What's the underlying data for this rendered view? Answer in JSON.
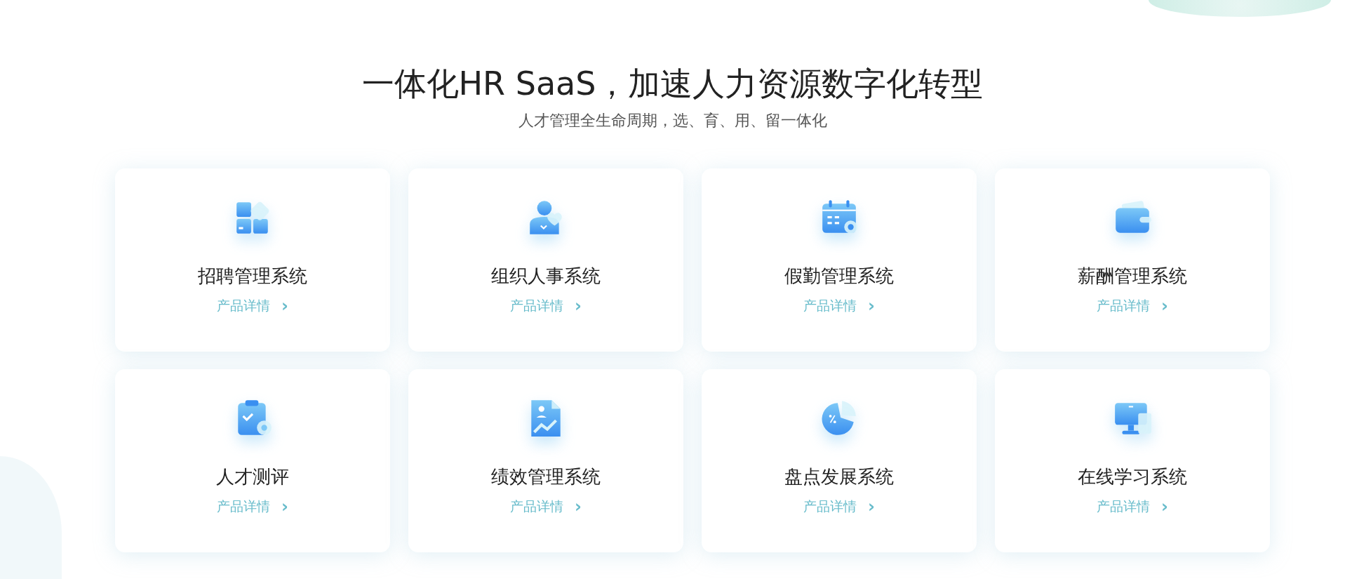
{
  "heading": {
    "title": "一体化HR SaaS，加速人力资源数字化转型",
    "subtitle": "人才管理全生命周期，选、育、用、留一体化"
  },
  "products": [
    {
      "kind": "blocks",
      "name": "招聘管理系统",
      "link": "产品详情",
      "arrow": "›"
    },
    {
      "kind": "person",
      "name": "组织人事系统",
      "link": "产品详情",
      "arrow": "›"
    },
    {
      "kind": "calendar",
      "name": "假勤管理系统",
      "link": "产品详情",
      "arrow": "›"
    },
    {
      "kind": "wallet",
      "name": "薪酬管理系统",
      "link": "产品详情",
      "arrow": "›"
    },
    {
      "kind": "clipboard",
      "name": "人才测评",
      "link": "产品详情",
      "arrow": "›"
    },
    {
      "kind": "chart",
      "name": "绩效管理系统",
      "link": "产品详情",
      "arrow": "›"
    },
    {
      "kind": "pie",
      "name": "盘点发展系统",
      "link": "产品详情",
      "arrow": "›"
    },
    {
      "kind": "monitor",
      "name": "在线学习系统",
      "link": "产品详情",
      "arrow": "›"
    }
  ]
}
